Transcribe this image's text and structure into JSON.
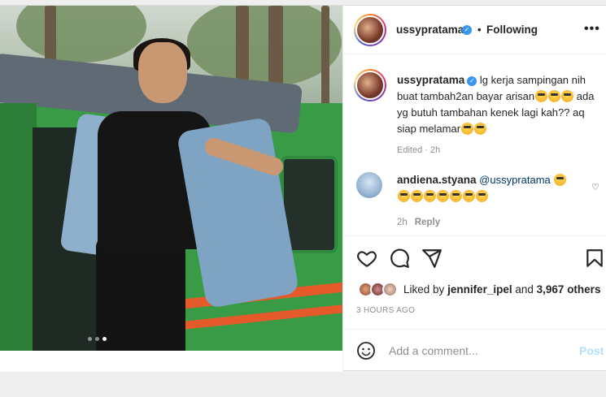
{
  "post": {
    "author": "ussypratama",
    "verified_icon": "verified-badge-icon",
    "follow_state": "Following",
    "separator": "•",
    "more_icon": "more-options-icon",
    "carousel": {
      "count": 3,
      "active_index": 3
    }
  },
  "caption": {
    "username": "ussypratama",
    "line1": "lg kerja sampingan nih buat tambah2an bayar arisan",
    "line2": "ada yg butuh tambahan kenek lagi kah?? aq siap melamar",
    "meta": "Edited · 2h"
  },
  "comment": {
    "username": "andiena.styana",
    "mention": "@ussypratama",
    "emoji_row_count": 7,
    "time": "2h",
    "reply_label": "Reply",
    "heart_icon": "like-comment-heart-icon"
  },
  "actions": {
    "like_icon": "heart-icon",
    "comment_icon": "comment-icon",
    "share_icon": "share-icon",
    "save_icon": "bookmark-icon"
  },
  "likes": {
    "prefix": "Liked by",
    "user": "jennifer_ipel",
    "conj": "and",
    "count": "3,967 others"
  },
  "timestamp": "3 HOURS AGO",
  "add_comment": {
    "placeholder": "Add a comment...",
    "post_label": "Post",
    "emoji_icon": "emoji-smile-icon"
  },
  "colors": {
    "link": "#00376b",
    "muted": "#8e8e8e",
    "post_disabled": "#b2dffc",
    "verified": "#3897f0"
  }
}
